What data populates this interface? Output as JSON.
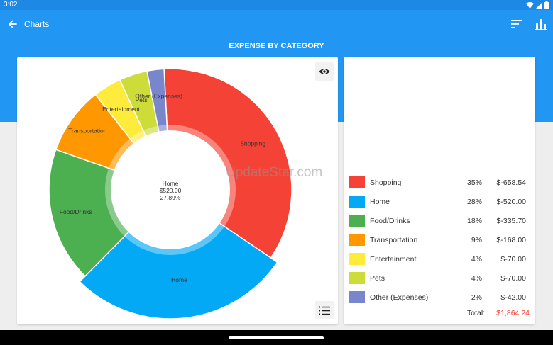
{
  "status_bar": {
    "time": "3:02"
  },
  "app_bar": {
    "title": "Charts",
    "back_icon": "arrow-back-icon",
    "sort_icon": "sort-icon",
    "chart_icon": "bar-chart-icon"
  },
  "section": {
    "title": "EXPENSE BY CATEGORY"
  },
  "chart_center": {
    "name": "Home",
    "amount": "$520.00",
    "percent": "27.89%"
  },
  "chart_data": {
    "type": "pie",
    "categories": [
      "Shopping",
      "Home",
      "Food/Drinks",
      "Transportation",
      "Entertainment",
      "Pets",
      "Other (Expenses)"
    ],
    "values": [
      658.54,
      520.0,
      335.7,
      168.0,
      70.0,
      70.0,
      42.0
    ],
    "colors": [
      "#f44336",
      "#03a9f4",
      "#4caf50",
      "#ff9800",
      "#ffeb3b",
      "#cddc39",
      "#7986cb"
    ],
    "highlighted": "Home"
  },
  "legend": {
    "rows": [
      {
        "name": "Shopping",
        "percent": "35%",
        "amount": "$-658.54",
        "color": "#f44336"
      },
      {
        "name": "Home",
        "percent": "28%",
        "amount": "$-520.00",
        "color": "#03a9f4"
      },
      {
        "name": "Food/Drinks",
        "percent": "18%",
        "amount": "$-335.70",
        "color": "#4caf50"
      },
      {
        "name": "Transportation",
        "percent": "9%",
        "amount": "$-168.00",
        "color": "#ff9800"
      },
      {
        "name": "Entertainment",
        "percent": "4%",
        "amount": "$-70.00",
        "color": "#ffeb3b"
      },
      {
        "name": "Pets",
        "percent": "4%",
        "amount": "$-70.00",
        "color": "#cddc39"
      },
      {
        "name": "Other (Expenses)",
        "percent": "2%",
        "amount": "$-42.00",
        "color": "#7986cb"
      }
    ],
    "total_label": "Total:",
    "total_value": "$1,864.24"
  },
  "watermark": "UpdateStar.com"
}
